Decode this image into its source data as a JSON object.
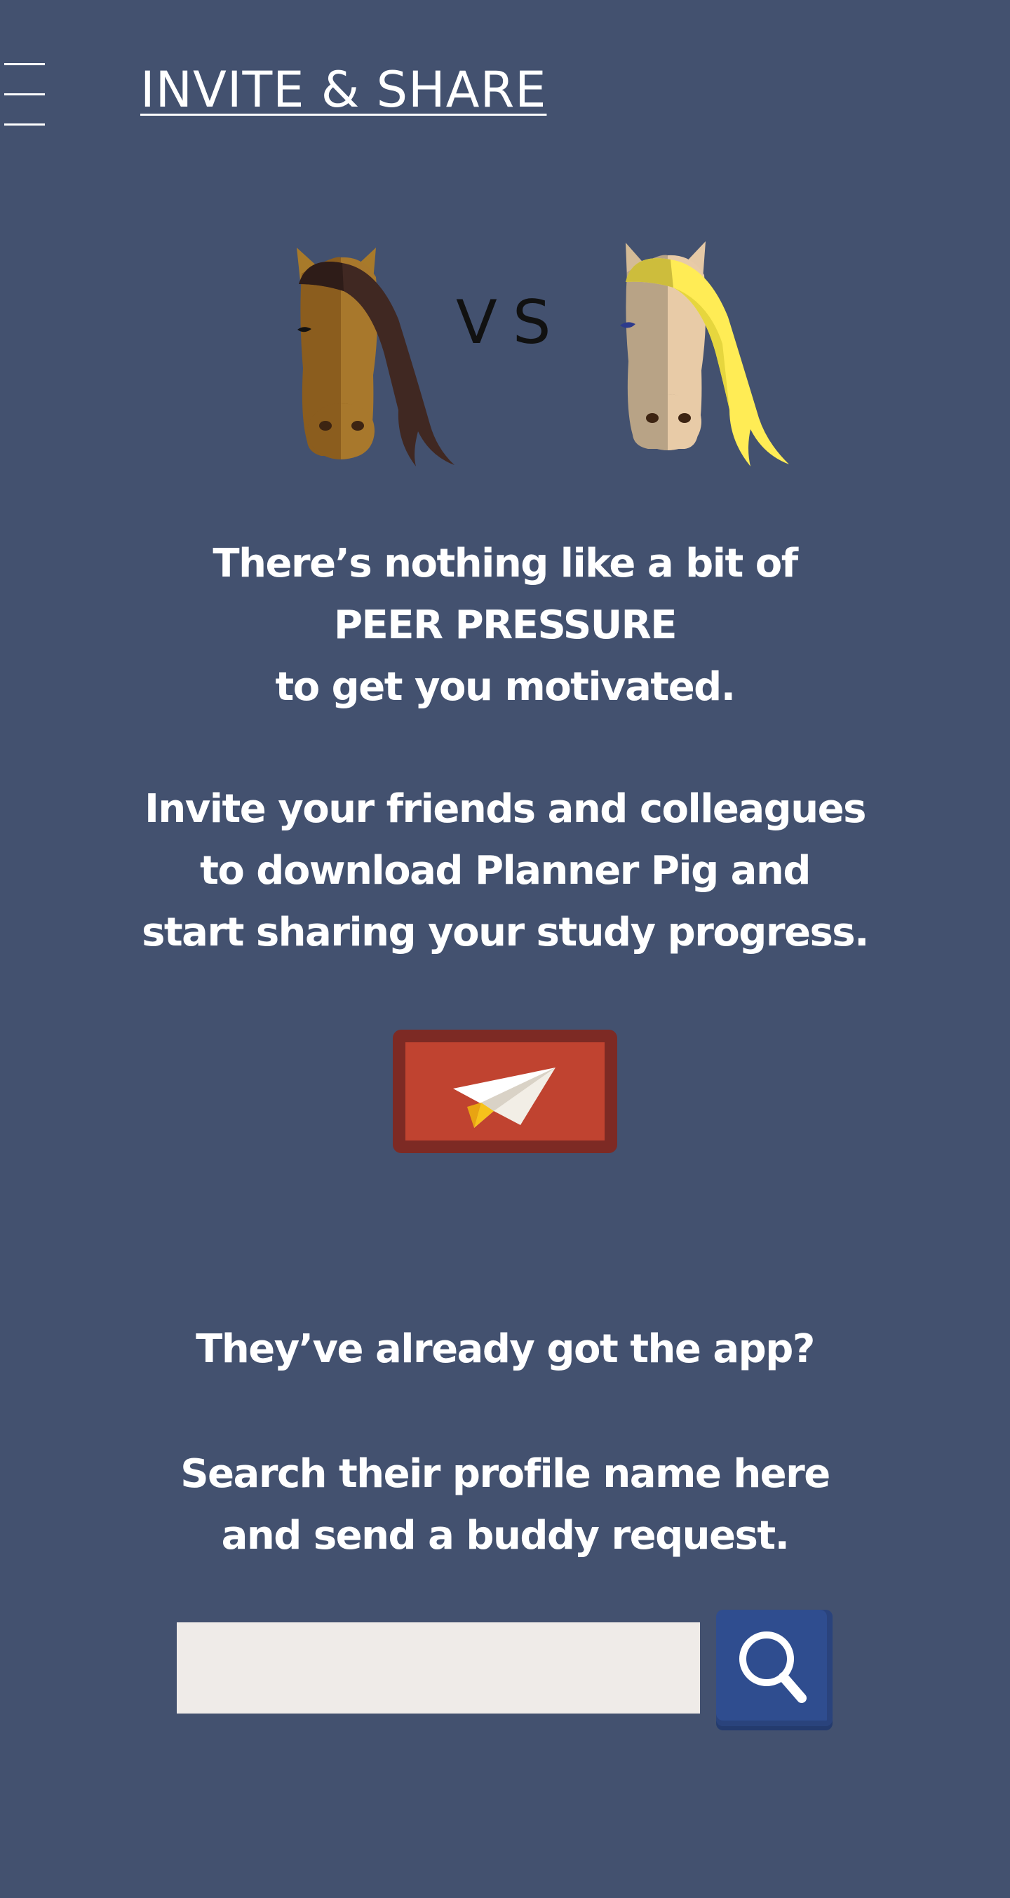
{
  "header": {
    "title": "INVITE & SHARE",
    "menu_icon": "hamburger-menu-icon"
  },
  "hero": {
    "left_icon": "brown-horse-icon",
    "vs_label": "VS",
    "right_icon": "blonde-horse-icon"
  },
  "intro": {
    "lines": [
      "There’s nothing like a bit of",
      "PEER PRESSURE",
      "to get you motivated."
    ]
  },
  "invite": {
    "lines": [
      "Invite your friends and colleagues",
      "to download Planner Pig and",
      "start sharing your study progress."
    ],
    "send_button_icon": "paper-plane-icon"
  },
  "existing_users": {
    "question": "They’ve already got the app?",
    "lines": [
      "Search their profile name here",
      "and send a buddy request."
    ]
  },
  "search": {
    "value": "",
    "placeholder": "",
    "button_icon": "search-icon"
  },
  "colors": {
    "background": "#43516f",
    "send_button": "#c04330",
    "send_button_border": "#7d2a24",
    "search_button": "#2f4d8f",
    "search_input": "#efebe8"
  }
}
